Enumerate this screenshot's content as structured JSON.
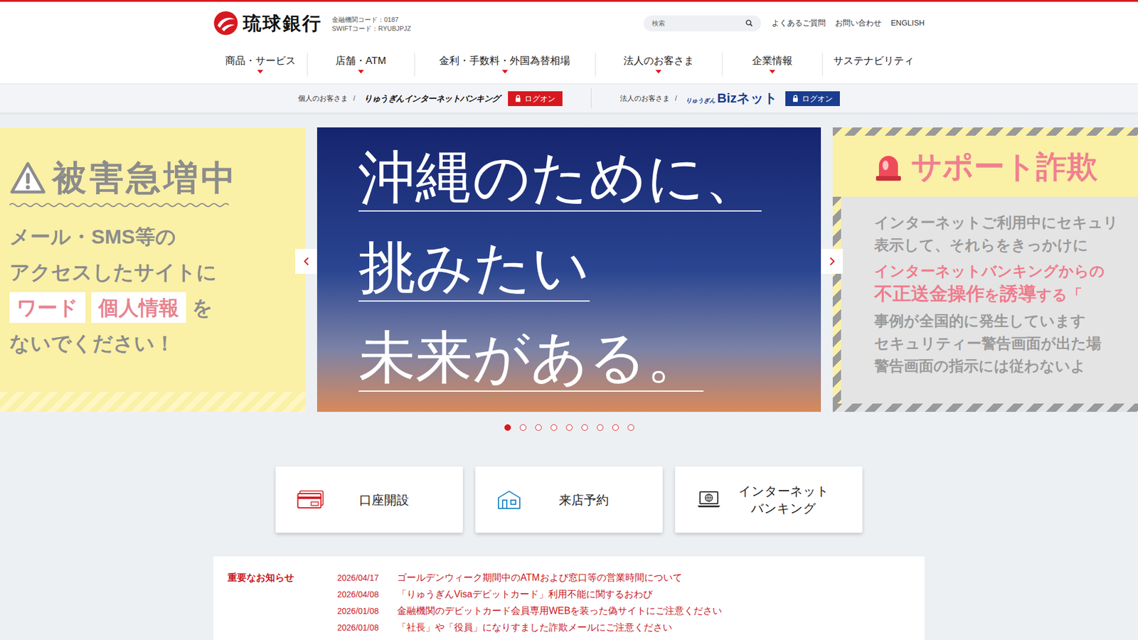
{
  "header": {
    "logo": "琉球銀行",
    "bank_code": "金融機関コード：0187",
    "swift_code": "SWIFTコード：RYUBJPJZ",
    "search": {
      "placeholder": "検索"
    },
    "links": [
      "よくあるご質問",
      "お問い合わせ",
      "ENGLISH"
    ]
  },
  "nav": [
    {
      "label": "商品・サービス",
      "has_menu": true
    },
    {
      "label": "店舗・ATM",
      "has_menu": true
    },
    {
      "label": "金利・手数料・外国為替相場",
      "has_menu": true
    },
    {
      "label": "法人のお客さま",
      "has_menu": true
    },
    {
      "label": "企業情報",
      "has_menu": true
    },
    {
      "label": "サステナビリティ",
      "has_menu": false
    }
  ],
  "login_bar": [
    {
      "audience": "個人のお客さま",
      "separator": "/",
      "service": [
        "りゅうぎんインターネットバンキング"
      ],
      "button": "ログオン",
      "color": "#d7191f"
    },
    {
      "audience": "法人のお客さま",
      "separator": "/",
      "service": [
        "りゅうぎん",
        "Bizネット"
      ],
      "button": "ログオン",
      "color": "#1a3d8f"
    }
  ],
  "carousel": {
    "slides": [
      {
        "kind": "phishing-warning",
        "title": "被害急増中",
        "lines": [
          [
            {
              "text": "メール・SMS等の",
              "highlight": false,
              "large": false
            }
          ],
          [
            {
              "text": "アクセスしたサイトに",
              "highlight": false,
              "large": false
            }
          ],
          [
            {
              "text": "ワード",
              "highlight": true,
              "large": false
            },
            {
              "text": "個人情報",
              "highlight": true,
              "large": false
            },
            {
              "text": "を",
              "highlight": false,
              "large": false
            }
          ],
          [
            {
              "text": "ないでください！",
              "highlight": false,
              "large": false
            }
          ]
        ]
      },
      {
        "kind": "campaign",
        "title": "",
        "lines": [
          [
            {
              "text": "沖縄のために、",
              "highlight": false,
              "large": true
            }
          ],
          [
            {
              "text": "挑みたい",
              "highlight": false,
              "large": true
            }
          ],
          [
            {
              "text": "未来がある。",
              "highlight": false,
              "large": true
            }
          ]
        ]
      },
      {
        "kind": "support-scam",
        "title": "サポート詐欺",
        "lines": [
          [
            {
              "text": "インターネットご利用中にセキュリ",
              "highlight": false,
              "large": false
            }
          ],
          [
            {
              "text": "表示して、それらをきっかけに",
              "highlight": false,
              "large": false
            }
          ],
          [
            {
              "text": "インターネットバンキングからの",
              "highlight": true,
              "large": false
            }
          ],
          [
            {
              "text": "不正送金操作",
              "highlight": true,
              "large": true
            },
            {
              "text": "を",
              "highlight": true,
              "large": false
            },
            {
              "text": "誘導",
              "highlight": true,
              "large": true
            },
            {
              "text": "する「",
              "highlight": true,
              "large": false
            }
          ],
          [
            {
              "text": "事例が全国的に発生しています",
              "highlight": false,
              "large": false
            }
          ],
          [
            {
              "text": "セキュリティー警告画面が出た場",
              "highlight": false,
              "large": false
            }
          ],
          [
            {
              "text": "警告画面の指示には従わないよ",
              "highlight": false,
              "large": false
            }
          ]
        ]
      }
    ],
    "dots": [
      {
        "selected": true
      },
      {
        "selected": false
      },
      {
        "selected": false
      },
      {
        "selected": false
      },
      {
        "selected": false
      },
      {
        "selected": false
      },
      {
        "selected": false
      },
      {
        "selected": false
      },
      {
        "selected": false
      }
    ]
  },
  "quick_links": [
    {
      "kind": "account",
      "lines": [
        "口座開設"
      ]
    },
    {
      "kind": "reservation",
      "lines": [
        "来店予約"
      ]
    },
    {
      "kind": "banking",
      "lines": [
        "インターネット",
        "バンキング"
      ]
    }
  ],
  "news": {
    "heading": "重要なお知らせ",
    "items": [
      {
        "date": "2026/04/17",
        "title": "ゴールデンウィーク期間中のATMおよび窓口等の営業時間について"
      },
      {
        "date": "2026/04/08",
        "title": "「りゅうぎんVisaデビットカード」利用不能に関するおわび"
      },
      {
        "date": "2026/01/08",
        "title": "金融機関のデビットカード会員専用WEBを装った偽サイトにご注意ください"
      },
      {
        "date": "2026/01/08",
        "title": "「社長」や「役員」になりすました詐欺メールにご注意ください"
      }
    ]
  }
}
